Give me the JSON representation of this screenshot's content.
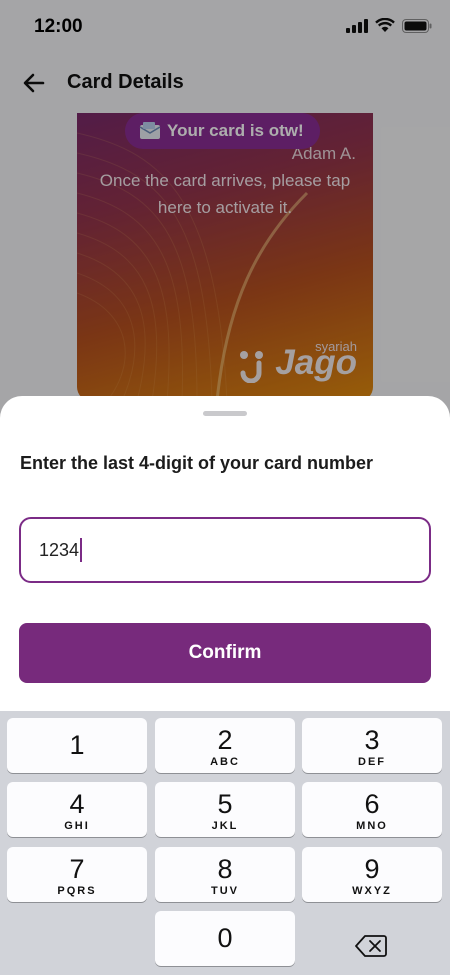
{
  "status_bar": {
    "time": "12:00"
  },
  "header": {
    "title": "Card Details"
  },
  "card": {
    "badge": "Your card is otw!",
    "holder_name": "Adam A.",
    "message": "Once the card arrives, please tap here to activate it.",
    "brand_small": "syariah",
    "brand": "Jago"
  },
  "sheet": {
    "title": "Enter the last 4-digit of your card number",
    "input_value": "1234",
    "confirm_label": "Confirm"
  },
  "keyboard": {
    "keys": [
      {
        "num": "1",
        "letters": ""
      },
      {
        "num": "2",
        "letters": "ABC"
      },
      {
        "num": "3",
        "letters": "DEF"
      },
      {
        "num": "4",
        "letters": "GHI"
      },
      {
        "num": "5",
        "letters": "JKL"
      },
      {
        "num": "6",
        "letters": "MNO"
      },
      {
        "num": "7",
        "letters": "PQRS"
      },
      {
        "num": "8",
        "letters": "TUV"
      },
      {
        "num": "9",
        "letters": "WXYZ"
      },
      {
        "num": "0",
        "letters": ""
      }
    ]
  },
  "colors": {
    "brand_purple": "#772a7c",
    "input_border": "#7b2b86",
    "keyboard_bg": "#d1d3d9"
  }
}
